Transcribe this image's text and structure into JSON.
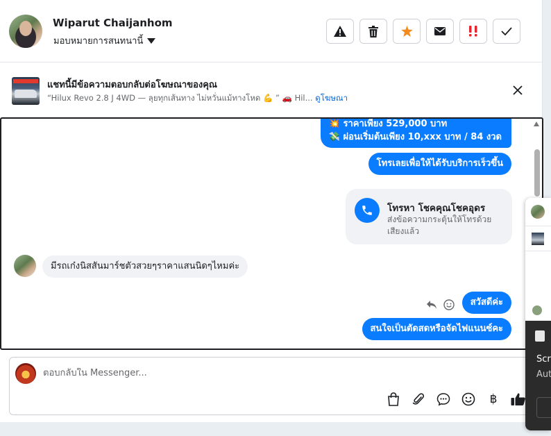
{
  "header": {
    "name": "Wiparut Chaijanhom",
    "assign_label": "มอบหมายการสนทนานี้"
  },
  "toolbar": {
    "icons": [
      "warning-icon",
      "trash-icon",
      "star-icon",
      "envelope-icon",
      "double-exclamation-icon",
      "check-icon"
    ],
    "star_color": "#f28b1c",
    "alert_color": "#e4262f"
  },
  "ad_bar": {
    "title": "แชทนี้มีข้อความตอบกลับต่อโฆษณาของคุณ",
    "subtitle": "“Hilux Revo 2.8 J 4WD — ลุยทุกเส้นทาง ไม่หวั่นแม้ทางโหด 💪 ” 🚗 Hil...",
    "link": "ดูโฆษณา"
  },
  "thread": {
    "messages": [
      {
        "side": "out",
        "lines": [
          "💥 ราคาเพียง 529,000 บาท",
          "💸 ผ่อนเริ่มต้นเพียง 10,xxx บาท / 84 งวด"
        ]
      },
      {
        "side": "out",
        "text": "โทรเลยเพื่อให้ได้รับบริการเร็วขึ้น"
      },
      {
        "side": "in",
        "text": "มีรถเก๋งนิสสันมาร์ชตัวสวยๆราคาแสนนิดๆไหมค่ะ"
      },
      {
        "side": "out",
        "text": "สวัสดีค่ะ"
      },
      {
        "side": "out",
        "text": "สนใจเป็นตัดสดหรือจัดไฟแนนซ์คะ"
      }
    ],
    "call_card": {
      "title": "โทรหา โชคคุณโชคอุดร",
      "description": "ส่งข้อความกระตุ้นให้โทรด้วยเสียงแล้ว"
    }
  },
  "composer": {
    "placeholder": "ตอบกลับใน Messenger...",
    "icons": [
      "shopping-bag-icon",
      "paperclip-icon",
      "chat-bubble-icon",
      "emoji-icon",
      "baht-icon",
      "thumbs-up-icon"
    ],
    "baht_symbol": "฿"
  },
  "overlay": {
    "line1": "Scre",
    "line2": "Aut"
  },
  "colors": {
    "accent": "#0a7cff",
    "link": "#0a66d8"
  }
}
